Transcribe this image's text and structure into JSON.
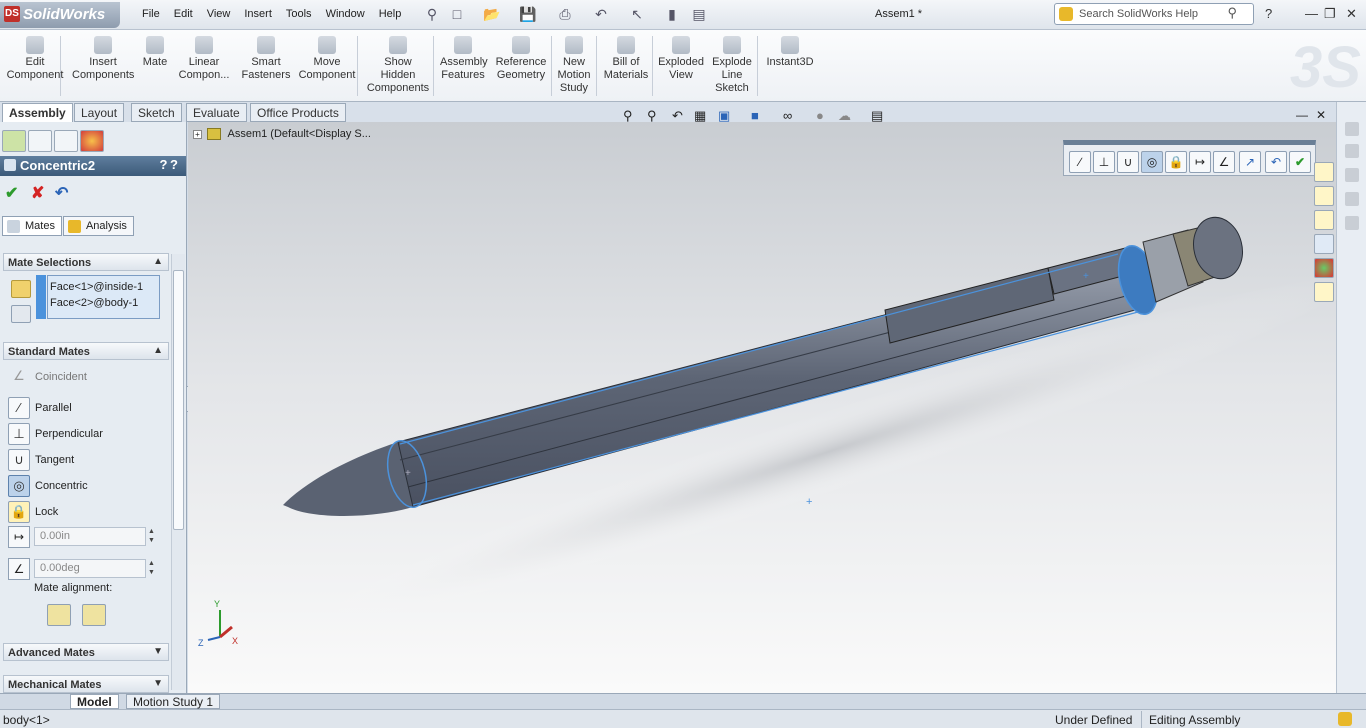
{
  "app": {
    "logo": "SolidWorks",
    "doc_title": "Assem1 *"
  },
  "menu": [
    "File",
    "Edit",
    "View",
    "Insert",
    "Tools",
    "Window",
    "Help"
  ],
  "search": {
    "placeholder": "Search SolidWorks Help"
  },
  "commands": [
    {
      "label": "Edit\nComponent",
      "icon": "edit-component-icon"
    },
    {
      "label": "Insert\nComponents",
      "icon": "insert-components-icon"
    },
    {
      "label": "Mate",
      "icon": "mate-icon"
    },
    {
      "label": "Linear\nCompon...",
      "icon": "linear-pattern-icon"
    },
    {
      "label": "Smart\nFasteners",
      "icon": "smart-fasteners-icon"
    },
    {
      "label": "Move\nComponent",
      "icon": "move-component-icon"
    },
    {
      "label": "Show\nHidden\nComponents",
      "icon": "show-hidden-icon"
    },
    {
      "label": "Assembly\nFeatures",
      "icon": "assembly-features-icon"
    },
    {
      "label": "Reference\nGeometry",
      "icon": "reference-geometry-icon"
    },
    {
      "label": "New\nMotion\nStudy",
      "icon": "motion-study-icon"
    },
    {
      "label": "Bill of\nMaterials",
      "icon": "bom-icon"
    },
    {
      "label": "Exploded\nView",
      "icon": "exploded-view-icon"
    },
    {
      "label": "Explode\nLine\nSketch",
      "icon": "explode-line-icon"
    },
    {
      "label": "Instant3D",
      "icon": "instant3d-icon"
    }
  ],
  "tabs": [
    "Assembly",
    "Layout",
    "Sketch",
    "Evaluate",
    "Office Products"
  ],
  "property_manager": {
    "title": "Concentric2",
    "subtabs": [
      "Mates",
      "Analysis"
    ],
    "mate_selections": {
      "heading": "Mate Selections",
      "items": [
        "Face<1>@inside-1",
        "Face<2>@body-1"
      ]
    },
    "standard_mates": {
      "heading": "Standard Mates",
      "items": [
        "Coincident",
        "Parallel",
        "Perpendicular",
        "Tangent",
        "Concentric",
        "Lock"
      ],
      "selected": "Concentric",
      "distance": "0.00in",
      "angle": "0.00deg",
      "alignment_label": "Mate alignment:"
    },
    "advanced_heading": "Advanced Mates",
    "mechanical_heading": "Mechanical Mates"
  },
  "tree": {
    "root": "Assem1  (Default<Display S..."
  },
  "bottom_tabs": [
    "Model",
    "Motion Study 1"
  ],
  "status": {
    "selection": "body<1>",
    "definition": "Under Defined",
    "mode": "Editing Assembly"
  },
  "colors": {
    "accent": "#4b92dc",
    "header": "#3c5a79"
  }
}
